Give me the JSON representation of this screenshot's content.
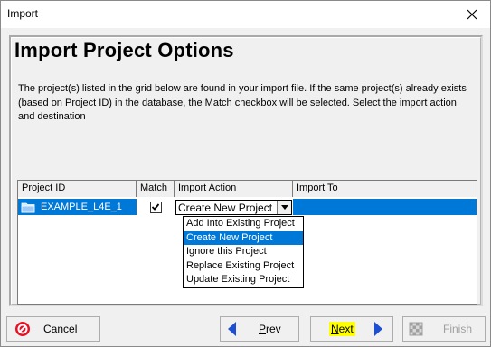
{
  "window": {
    "title": "Import"
  },
  "heading": "Import Project Options",
  "description": "The project(s) listed in the grid below are found in your import file. If the same project(s) already exists (based on Project ID) in the database, the Match checkbox will be selected.  Select the import action and destination",
  "grid": {
    "columns": [
      "Project ID",
      "Match",
      "Import Action",
      "Import To"
    ],
    "rows": [
      {
        "project_id": "EXAMPLE_L4E_1",
        "match": true,
        "import_action": "Create New Project",
        "import_to": ""
      }
    ]
  },
  "dropdown": {
    "options": [
      "Add Into Existing Project",
      "Create New Project",
      "Ignore this Project",
      "Replace Existing Project",
      "Update Existing Project"
    ],
    "selected": "Create New Project"
  },
  "buttons": {
    "cancel": "Cancel",
    "prev_mnemonic": "P",
    "prev_rest": "rev",
    "next_mnemonic": "N",
    "next_rest": "ext",
    "finish": "Finish"
  },
  "colors": {
    "selection": "#0078d7",
    "highlight": "#ffff00",
    "cancel_icon": "#e81123",
    "nav_arrow": "#1f4fd1"
  }
}
